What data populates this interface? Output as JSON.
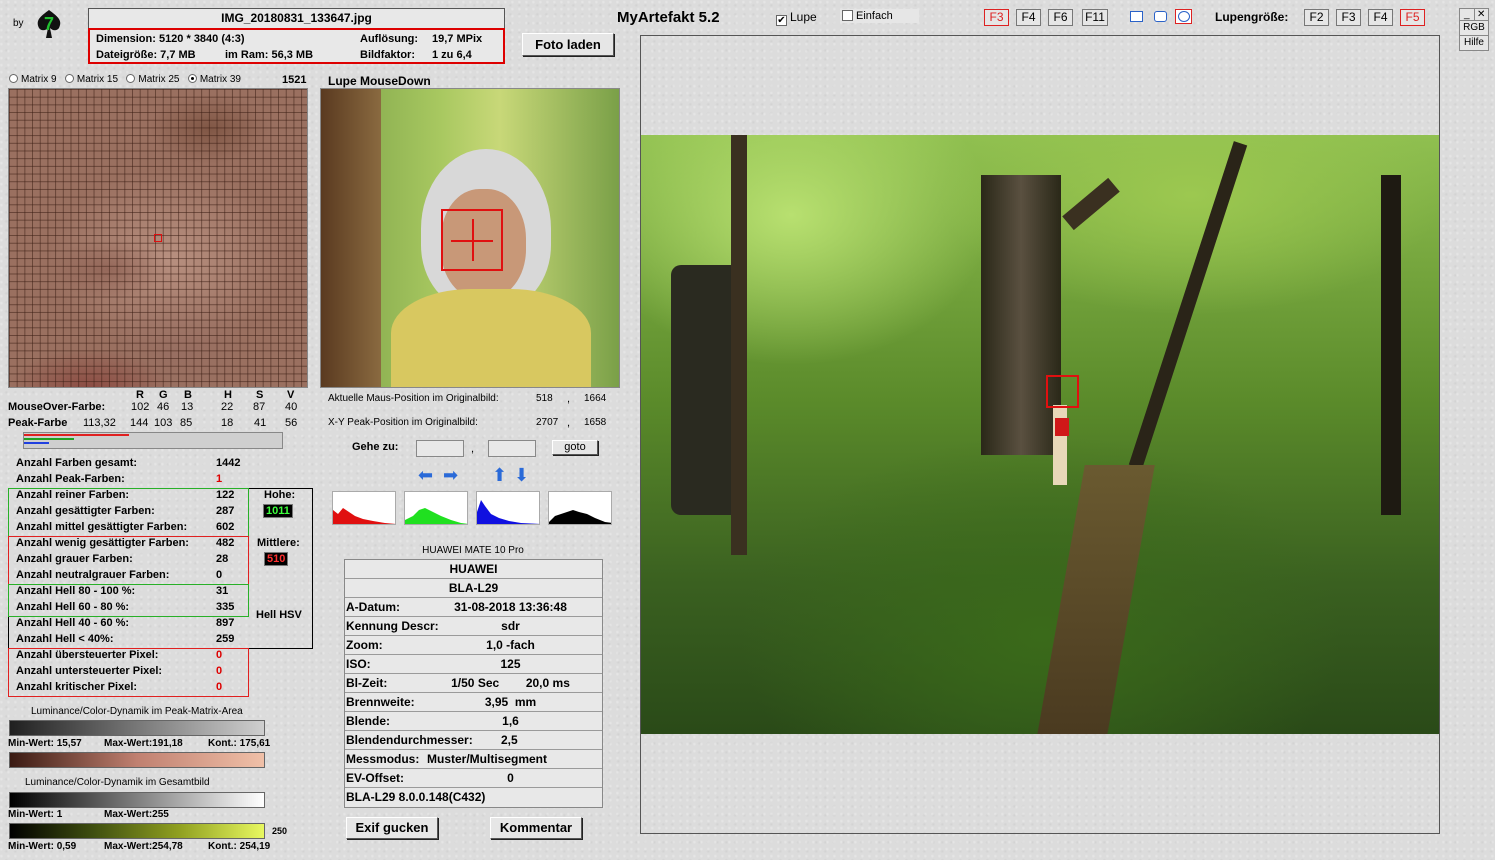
{
  "header": {
    "by": "by",
    "logo_char": "7",
    "filename": "IMG_20180831_133647.jpg",
    "app_title": "MyArtefakt 5.2",
    "foto_button": "Foto laden"
  },
  "info": {
    "dimension": "Dimension: 5120 * 3840 (4:3)",
    "aufl_label": "Auflösung:",
    "aufl_value": "19,7 MPix",
    "dateigroesse": "Dateigröße: 7,7 MB",
    "ram": "im Ram: 56,3 MB",
    "bildfaktor_label": "Bildfaktor:",
    "bildfaktor_value": "1 zu 6,4"
  },
  "toolbar": {
    "lupe": "Lupe",
    "lupe_checked": "✔",
    "einfach": "Einfach",
    "keys_left": [
      "F3",
      "F4",
      "F6",
      "F11"
    ],
    "lupengroesse": "Lupengröße:",
    "keys_right": [
      "F2",
      "F3",
      "F4",
      "F5"
    ],
    "close": "✕",
    "rgb": "RGB",
    "hilfe": "Hilfe"
  },
  "matrix": {
    "options": [
      "Matrix 9",
      "Matrix 15",
      "Matrix 25",
      "Matrix 39"
    ],
    "selected": "Matrix 39",
    "count": "1521",
    "lupe_title": "Lupe MouseDown"
  },
  "colors": {
    "headers": [
      "R",
      "G",
      "B",
      "H",
      "S",
      "V"
    ],
    "mouseover_label": "MouseOver-Farbe:",
    "mouseover": [
      "102",
      "46",
      "13",
      "22",
      "87",
      "40"
    ],
    "peak_label": "Peak-Farbe",
    "peak_extra": "113,32",
    "peak": [
      "144",
      "103",
      "85",
      "18",
      "41",
      "56"
    ]
  },
  "position": {
    "maus_label": "Aktuelle Maus-Position  im Originalbild:",
    "maus_x": "518",
    "maus_y": "1664",
    "peak_label": "X-Y Peak-Position  im Originalbild:",
    "peak_x": "2707",
    "peak_y": "1658",
    "sep": ",",
    "gehe_zu": "Gehe zu:",
    "goto": "goto"
  },
  "stats": {
    "gesamt_label": "Anzahl Farben gesamt:",
    "gesamt": "1442",
    "peak_label": "Anzahl Peak-Farben:",
    "peak": "1",
    "rows": [
      {
        "label": "Anzahl reiner Farben:",
        "value": "122"
      },
      {
        "label": "Anzahl gesättigter Farben:",
        "value": "287"
      },
      {
        "label": "Anzahl mittel gesättigter Farben:",
        "value": "602"
      },
      {
        "label": "Anzahl wenig gesättigter Farben:",
        "value": "482"
      },
      {
        "label": "Anzahl grauer Farben:",
        "value": "28"
      },
      {
        "label": "Anzahl neutralgrauer Farben:",
        "value": "0"
      },
      {
        "label": "Anzahl Hell 80 - 100 %:",
        "value": "31"
      },
      {
        "label": "Anzahl Hell 60 - 80 %:",
        "value": "335"
      },
      {
        "label": "Anzahl Hell 40 - 60 %:",
        "value": "897"
      },
      {
        "label": "Anzahl Hell < 40%:",
        "value": "259"
      },
      {
        "label": "Anzahl übersteuerter Pixel:",
        "value": "0"
      },
      {
        "label": "Anzahl untersteuerter Pixel:",
        "value": "0"
      },
      {
        "label": "Anzahl kritischer Pixel:",
        "value": "0"
      }
    ],
    "hohe_label": "Hohe:",
    "hohe": "1011",
    "mittlere_label": "Mittlere:",
    "mittlere": "510",
    "hell_hsv": "Hell HSV"
  },
  "dynamics": {
    "peak_title": "Luminance/Color-Dynamik im Peak-Matrix-Area",
    "peak_min": "Min-Wert: 15,57",
    "peak_max": "Max-Wert:191,18",
    "peak_kont": "Kont.: 175,61",
    "gesamt_title": "Luminance/Color-Dynamik im Gesamtbild",
    "g_min1": "Min-Wert: 1",
    "g_max1": "Max-Wert:255",
    "g_250": "250",
    "g_min2": "Min-Wert: 0,59",
    "g_max2": "Max-Wert:254,78",
    "g_kont2": "Kont.: 254,19"
  },
  "exif": {
    "camera": "HUAWEI MATE 10 Pro",
    "rows": [
      {
        "label": "",
        "value": "HUAWEI",
        "center": true
      },
      {
        "label": "",
        "value": "BLA-L29",
        "center": true
      },
      {
        "label": "A-Datum:",
        "value": "31-08-2018 13:36:48"
      },
      {
        "label": "Kennung Descr:",
        "value": "sdr"
      },
      {
        "label": "Zoom:",
        "value": "1,0 -fach"
      },
      {
        "label": "ISO:",
        "value": "125"
      },
      {
        "label": "Bl-Zeit:",
        "value": "1/50 Sec        20,0 ms"
      },
      {
        "label": "Brennweite:",
        "value": "3,95  mm"
      },
      {
        "label": "Blende:",
        "value": "1,6"
      },
      {
        "label": "Blendendurchmesser:",
        "value": "2,5"
      },
      {
        "label": "Messmodus:",
        "value": "Muster/Multisegment"
      },
      {
        "label": "EV-Offset:",
        "value": "0"
      },
      {
        "label": "BLA-L29 8.0.0.148(C432)",
        "value": ""
      }
    ],
    "exif_button": "Exif gucken",
    "kommentar_button": "Kommentar"
  }
}
